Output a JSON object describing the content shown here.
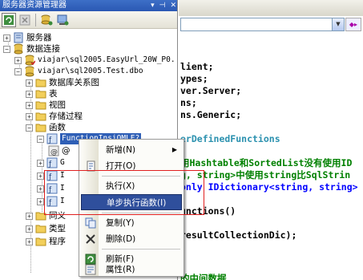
{
  "panel": {
    "title": "服务器资源管理器",
    "title_buttons": [
      "▾",
      "📌",
      "✕"
    ]
  },
  "toolbar": {
    "refresh_icon": "refresh-icon",
    "stop_icon": "stop-icon",
    "connect_db_icon": "connect-database-icon",
    "connect_server_icon": "connect-server-icon"
  },
  "tree": {
    "servers": "服务器",
    "data_connections": "数据连接",
    "conn1": "viajar\\sql2005.EasyUrl_20W_P0.",
    "conn2": "viajar\\sql2005.Test.dbo",
    "db_diagrams": "数据库关系图",
    "tables": "表",
    "views": "视图",
    "stored_procs": "存储过程",
    "functions": "函数",
    "fn_selected": "FunctionInsiOMLE?",
    "fn_child_partial": "@",
    "fn_row_1": "G",
    "fn_row_2": "I",
    "fn_row_3": "I",
    "fn_row_4": "I",
    "synonyms": "同义",
    "types": "类型",
    "assemblies": "程序"
  },
  "code": {
    "lines": [
      "lient;",
      "ypes;",
      "ver.Server;",
      "ns;",
      "ns.Generic;",
      "",
      "erDefinedFunctions",
      "",
      "用Hashtable和SortedList没有使用ID",
      "g, string>中使用string比SqlStrin",
      "only IDictionary<string, string>",
      "",
      "unctions()",
      "",
      "",
      "resultCollectionDic);",
      "",
      "",
      "",
      "",
      "的中间数据"
    ]
  },
  "menu": {
    "new": "新增(N)",
    "open": "打开(O)",
    "execute": "执行(X)",
    "step_into": "单步执行函数(I)",
    "copy": "复制(Y)",
    "delete": "删除(D)",
    "refresh": "刷新(F)",
    "properties": "属性(R)"
  },
  "colors": {
    "title_bar": "#2a58b3",
    "selection": "#2f5fb6",
    "menu_highlight": "#2f4f9c",
    "annotation_box": "#e02020"
  }
}
